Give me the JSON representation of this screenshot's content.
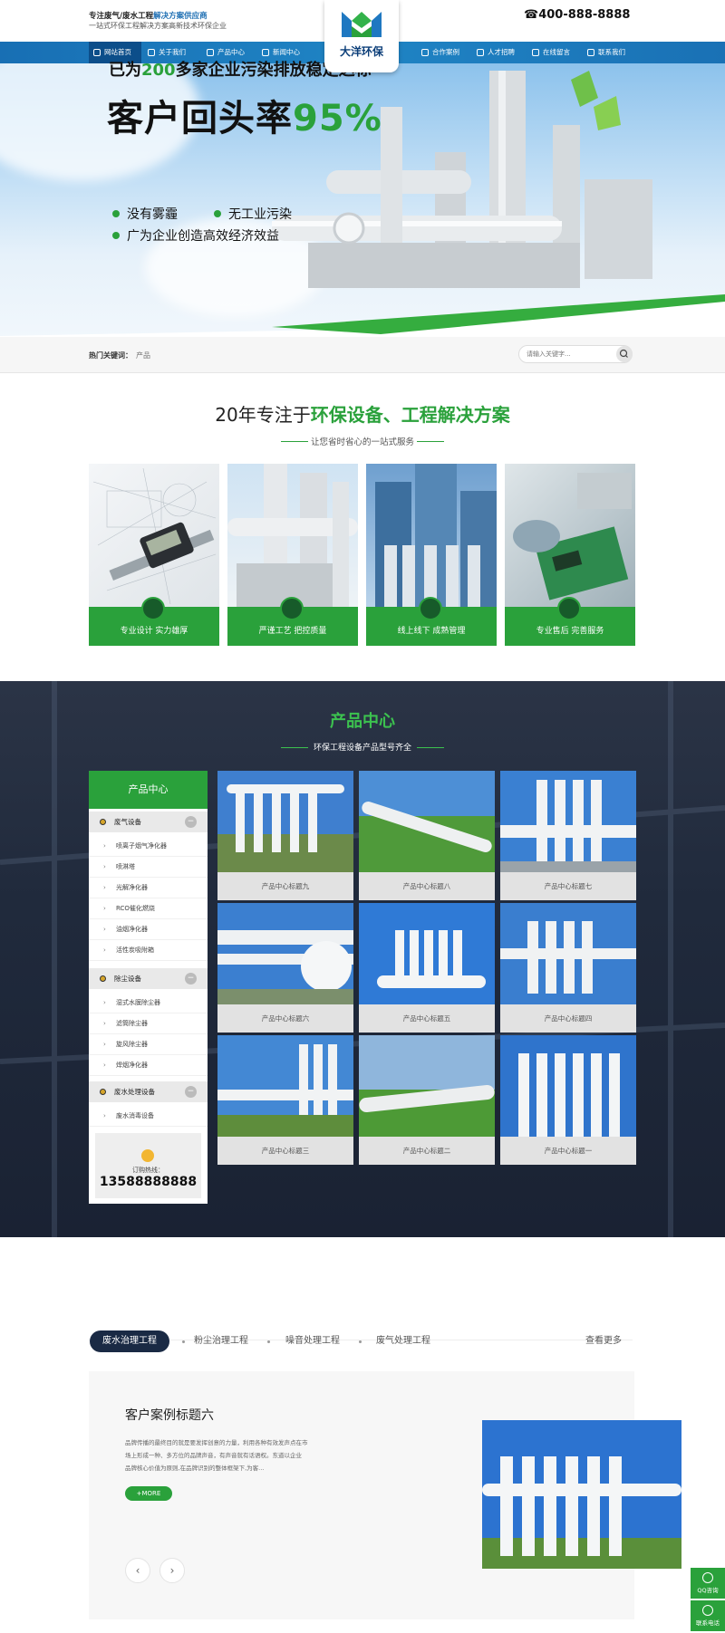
{
  "header": {
    "tagline_main": "专注废气/废水工程",
    "tagline_accent": "解决方案供应商",
    "tagline_sub": "一站式环保工程解决方案高新技术环保企业",
    "logo_name": "大洋环保",
    "phone": "400-888-8888"
  },
  "nav": {
    "items": [
      "网站首页",
      "关于我们",
      "产品中心",
      "新闻中心",
      "合作案例",
      "人才招聘",
      "在线留言",
      "联系我们"
    ]
  },
  "banner": {
    "line1_a": "已为",
    "line1_num": "200",
    "line1_b": "多家企业污染排放稳定达标",
    "line2_a": "客户回头率",
    "line2_num": "95%",
    "bullets": [
      "没有雾霾",
      "无工业污染",
      "广为企业创造高效经济效益"
    ]
  },
  "search": {
    "hot_label": "热门关键词：",
    "hot_value": "产品",
    "placeholder": "请输入关键字..."
  },
  "intro": {
    "title_a": "20年专注于",
    "title_b": "环保设备、工程解决方案",
    "subtitle": "让您省时省心的一站式服务",
    "cards": [
      "专业设计 实力雄厚",
      "严谨工艺 把控质量",
      "线上线下 成熟管理",
      "专业售后 完善服务"
    ]
  },
  "products": {
    "title": "产品中心",
    "subtitle": "环保工程设备产品型号齐全",
    "sidebar_title": "产品中心",
    "categories": [
      {
        "name": "废气设备",
        "toggle": "−",
        "subs": [
          "喷离子烟气净化器",
          "喷淋塔",
          "光解净化器",
          "RCO催化燃烧",
          "油烟净化器",
          "活性炭吸附箱"
        ]
      },
      {
        "name": "除尘设备",
        "toggle": "−",
        "subs": [
          "湿式水膜除尘器",
          "滤筒除尘器",
          "旋风除尘器",
          "焊烟净化器"
        ]
      },
      {
        "name": "废水处理设备",
        "toggle": "−",
        "subs": [
          "废水消毒设备"
        ]
      }
    ],
    "hotline_label": "订购热线：",
    "hotline": "13588888888",
    "items": [
      "产品中心标题九",
      "产品中心标题八",
      "产品中心标题七",
      "产品中心标题六",
      "产品中心标题五",
      "产品中心标题四",
      "产品中心标题三",
      "产品中心标题二",
      "产品中心标题一"
    ]
  },
  "cases": {
    "tabs": [
      "废水治理工程",
      "粉尘治理工程",
      "噪音处理工程",
      "废气处理工程"
    ],
    "more": "查看更多",
    "title": "客户案例标题六",
    "desc_lines": [
      "品牌传播的最终目的就是要发挥创意的力量，利用各种有效发声点在市",
      "场上形成一种、多方位的品牌声音，有声音就有话语权。东道以企业",
      "品牌核心价值为原则,在品牌识别的整体框架下,为客..."
    ],
    "more_btn": "+MORE",
    "prev": "‹",
    "next": "›"
  },
  "float": {
    "qq": "QQ咨询",
    "tel": "联系电话"
  },
  "colors": {
    "green": "#2aa13b",
    "blue_nav": "#1a75b9",
    "dark_bg": "#222b3d"
  }
}
